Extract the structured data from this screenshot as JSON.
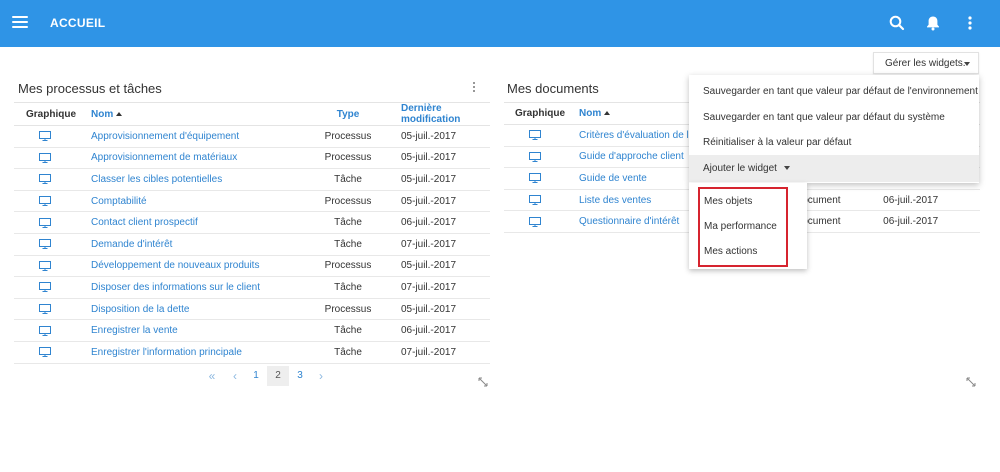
{
  "header": {
    "title": "ACCUEIL"
  },
  "toolbar": {
    "manage_widgets_label": "Gérer les widgets."
  },
  "processes_panel": {
    "title": "Mes processus et tâches",
    "columns": {
      "graphic": "Graphique",
      "name": "Nom",
      "type": "Type",
      "modified": "Dernière modification"
    },
    "rows": [
      {
        "name": "Approvisionnement d'équipement",
        "type": "Processus",
        "date": "05-juil.-2017"
      },
      {
        "name": "Approvisionnement de matériaux",
        "type": "Processus",
        "date": "05-juil.-2017"
      },
      {
        "name": "Classer les cibles potentielles",
        "type": "Tâche",
        "date": "05-juil.-2017"
      },
      {
        "name": "Comptabilité",
        "type": "Processus",
        "date": "05-juil.-2017"
      },
      {
        "name": "Contact client prospectif",
        "type": "Tâche",
        "date": "06-juil.-2017"
      },
      {
        "name": "Demande d'intérêt",
        "type": "Tâche",
        "date": "07-juil.-2017"
      },
      {
        "name": "Développement de nouveaux produits",
        "type": "Processus",
        "date": "05-juil.-2017"
      },
      {
        "name": "Disposer des informations sur le client",
        "type": "Tâche",
        "date": "07-juil.-2017"
      },
      {
        "name": "Disposition de la dette",
        "type": "Processus",
        "date": "05-juil.-2017"
      },
      {
        "name": "Enregistrer la vente",
        "type": "Tâche",
        "date": "06-juil.-2017"
      },
      {
        "name": "Enregistrer l'information principale",
        "type": "Tâche",
        "date": "07-juil.-2017"
      }
    ],
    "pagination": {
      "first": "«",
      "prev": "‹",
      "pages": [
        "1",
        "2",
        "3"
      ],
      "current": "2",
      "next": "›"
    }
  },
  "documents_panel": {
    "title": "Mes documents",
    "columns": {
      "graphic": "Graphique",
      "name": "Nom"
    },
    "rows": [
      {
        "name": "Critères d'évaluation de la s",
        "type": "",
        "date": ""
      },
      {
        "name": "Guide d'approche client",
        "type": "",
        "date": ""
      },
      {
        "name": "Guide de vente",
        "type": "",
        "date": ""
      },
      {
        "name": "Liste des ventes",
        "type": "ocument",
        "date": "06-juil.-2017"
      },
      {
        "name": "Questionnaire d'intérêt",
        "type": "ocument",
        "date": "06-juil.-2017"
      }
    ]
  },
  "widgets_menu": {
    "items": [
      "Sauvegarder en tant que valeur par défaut de l'environnement",
      "Sauvegarder en tant que valeur par défaut du système",
      "Réinitialiser à la valeur par défaut",
      "Ajouter le widget"
    ],
    "submenu": [
      "Mes objets",
      "Ma performance",
      "Mes actions"
    ]
  },
  "colors": {
    "topbar": "#2f94e6",
    "link": "#2f84d0",
    "highlight": "#d6242f"
  }
}
